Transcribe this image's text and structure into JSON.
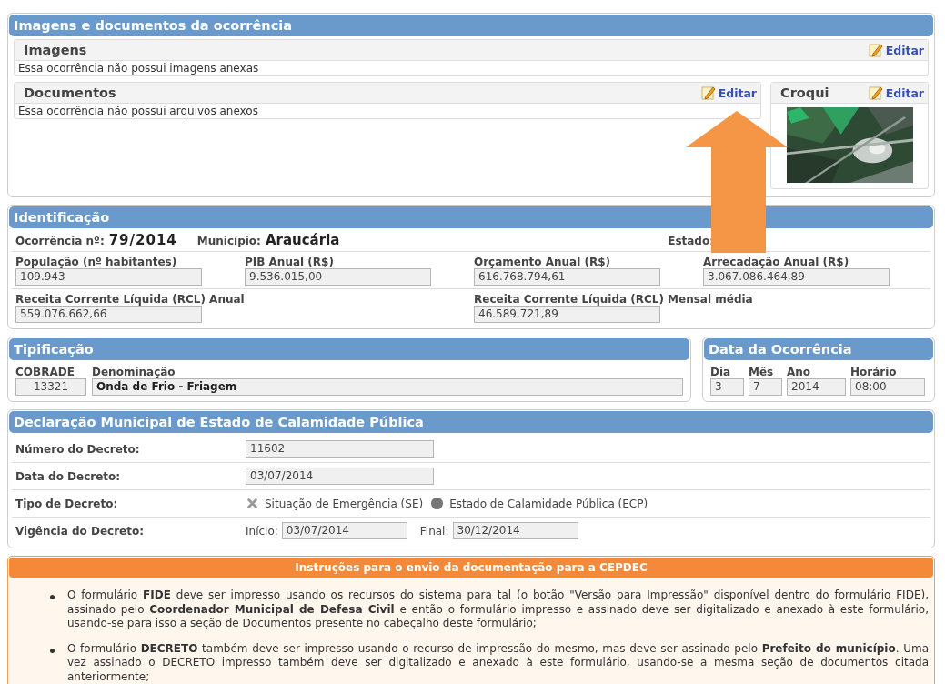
{
  "attachments": {
    "title": "Imagens e documentos da ocorrência",
    "images": {
      "title": "Imagens",
      "edit": "Editar",
      "message": "Essa ocorrência não possui imagens anexas"
    },
    "documents": {
      "title": "Documentos",
      "edit": "Editar",
      "message": "Essa ocorrência não possui arquivos anexos"
    },
    "sketch": {
      "title": "Croqui",
      "edit": "Editar"
    }
  },
  "identification": {
    "title": "Identificação",
    "occurrence_label": "Ocorrência nº:",
    "occurrence": "79/2014",
    "municipality_label": "Município:",
    "municipality": "Araucária",
    "state_label": "Estado:",
    "row_1": [
      {
        "label": "População (nº habitantes)",
        "value": "109.943"
      },
      {
        "label": "PIB Anual (R$)",
        "value": "9.536.015,00"
      },
      {
        "label": "Orçamento Anual (R$)",
        "value": "616.768.794,61"
      },
      {
        "label": "Arrecadação Anual (R$)",
        "value": "3.067.086.464,89"
      }
    ],
    "row_2": [
      {
        "label": "Receita Corrente Líquida (RCL) Anual",
        "value": "559.076.662,66"
      },
      {
        "label": "Receita Corrente Líquida (RCL) Mensal média",
        "value": "46.589.721,89"
      }
    ]
  },
  "typification": {
    "title": "Tipificação",
    "cobrade_label": "COBRADE",
    "name_label": "Denominação",
    "cobrade": "13321",
    "name": "Onda de Frio - Friagem"
  },
  "occurrence_date": {
    "title": "Data da Ocorrência",
    "fields": [
      {
        "label": "Dia",
        "value": "3"
      },
      {
        "label": "Mês",
        "value": "7"
      },
      {
        "label": "Ano",
        "value": "2014"
      },
      {
        "label": "Horário",
        "value": "08:00"
      }
    ]
  },
  "decree": {
    "title": "Declaração Municipal de Estado de Calamidade Pública",
    "number_label": "Número do Decreto:",
    "number": "11602",
    "date_label": "Data do Decreto:",
    "date": "03/07/2014",
    "type_label": "Tipo de Decreto:",
    "type_options": [
      {
        "label": "Situação de Emergência (SE)",
        "selected": false
      },
      {
        "label": "Estado de Calamidade Pública (ECP)",
        "selected": true
      }
    ],
    "validity_label": "Vigência do Decreto:",
    "start_label": "Início:",
    "start": "03/07/2014",
    "end_label": "Final:",
    "end": "30/12/2014"
  },
  "instructions": {
    "title": "Instruções para o envio da documentação para a CEPDEC",
    "items": [
      "O formulário **FIDE** deve ser impresso usando os recursos do sistema para tal (o botão \"Versão para Impressão\" disponível dentro do formulário FIDE), assinado pelo **Coordenador Municipal de Defesa Civil** e então o formulário impresso e assinado deve ser digitalizado e anexado à este formulário, usando-se para isso a seção de Documentos presente no cabeçalho deste formulário;",
      "O formulário **DECRETO** também deve ser impresso usando o recurso de impressão do mesmo, mas deve ser assinado pelo **Prefeito do município**. Uma vez assinado o DECRETO impresso também deve ser digitalizado e anexado à este formulário, usando-se a mesma seção de documentos citada anteriormente;"
    ]
  }
}
